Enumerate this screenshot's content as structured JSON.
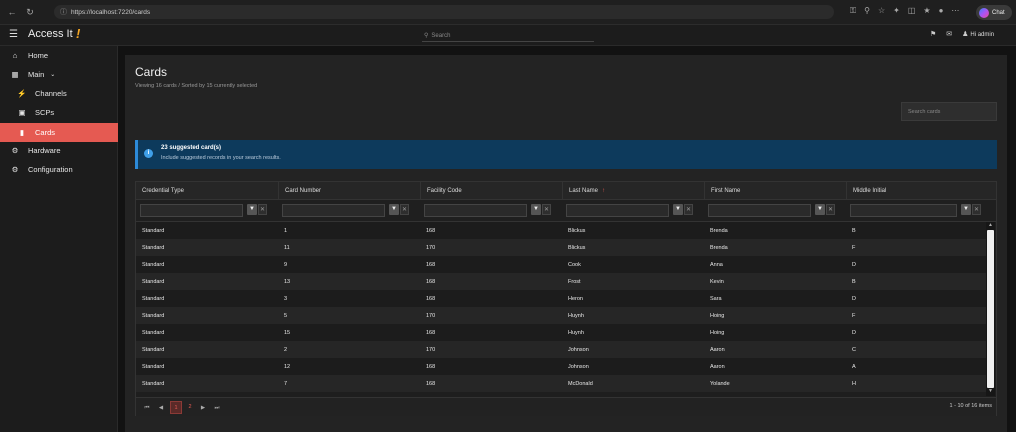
{
  "browser": {
    "url": "https://localhost:7220/cards",
    "copilot_label": "Chat"
  },
  "header": {
    "app_title": "Access It",
    "app_mark": "!",
    "search_placeholder": "Search",
    "user_label": "Hi admin"
  },
  "sidebar": {
    "items": [
      {
        "label": "Home",
        "icon": "home-icon"
      },
      {
        "label": "Main",
        "icon": "chart-icon"
      },
      {
        "label": "Channels",
        "icon": "plug-icon"
      },
      {
        "label": "SCPs",
        "icon": "monitor-icon"
      },
      {
        "label": "Cards",
        "icon": "card-icon"
      },
      {
        "label": "Hardware",
        "icon": "gear-icon"
      },
      {
        "label": "Configuration",
        "icon": "gear-icon"
      }
    ],
    "active": "Cards"
  },
  "page": {
    "title": "Cards",
    "subtitle": "Viewing 16 cards / Sorted by 15 currently selected",
    "search_placeholder": "Search cards"
  },
  "banner": {
    "title": "23 suggested card(s)",
    "subtitle": "Include suggested records in your search results."
  },
  "grid": {
    "columns": [
      "Credential Type",
      "Card Number",
      "Facility Code",
      "Last Name",
      "First Name",
      "Middle Initial"
    ],
    "sorted_column": "Last Name",
    "rows": [
      [
        "Standard",
        "1",
        "168",
        "Blickus",
        "Brenda",
        "B"
      ],
      [
        "Standard",
        "11",
        "170",
        "Blickus",
        "Brenda",
        "F"
      ],
      [
        "Standard",
        "9",
        "168",
        "Cook",
        "Anna",
        "D"
      ],
      [
        "Standard",
        "13",
        "168",
        "Frost",
        "Kevin",
        "B"
      ],
      [
        "Standard",
        "3",
        "168",
        "Heron",
        "Sara",
        "D"
      ],
      [
        "Standard",
        "5",
        "170",
        "Huynh",
        "Hoing",
        "F"
      ],
      [
        "Standard",
        "15",
        "168",
        "Huynh",
        "Hoing",
        "D"
      ],
      [
        "Standard",
        "2",
        "170",
        "Johnson",
        "Aaron",
        "C"
      ],
      [
        "Standard",
        "12",
        "168",
        "Johnson",
        "Aaron",
        "A"
      ],
      [
        "Standard",
        "7",
        "168",
        "McDonald",
        "Yolande",
        "H"
      ]
    ],
    "pages": [
      "1",
      "2"
    ],
    "current_page": "1",
    "items_info": "1 - 10 of 16 items"
  },
  "colors": {
    "accent": "#e55a52",
    "banner_bg": "#0d3a5c",
    "panel_bg": "#232323"
  }
}
